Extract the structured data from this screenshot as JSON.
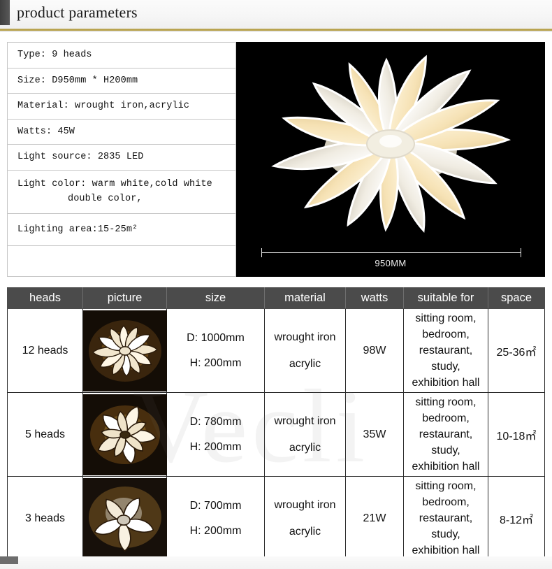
{
  "header": {
    "title": "product parameters"
  },
  "spec": {
    "rows": [
      {
        "text": "Type: 9 heads"
      },
      {
        "text": "Size: D950mm * H200mm"
      },
      {
        "text": "Material: wrought iron,acrylic"
      },
      {
        "text": "Watts: 45W"
      },
      {
        "text": "Light source: 2835 LED"
      },
      {
        "line1": "Light color: warm white,cold white",
        "line2": "double color,"
      },
      {
        "text": "Lighting area:15-25m²"
      },
      {
        "text": ""
      }
    ]
  },
  "photo": {
    "dimension_label": "950MM",
    "background_color": "#000000"
  },
  "comparison": {
    "headers": [
      "heads",
      "picture",
      "size",
      "material",
      "watts",
      "suitable for",
      "space"
    ],
    "rows": [
      {
        "heads": "12 heads",
        "picture": "lamp-12-heads-photo",
        "size_d": "D: 1000mm",
        "size_h": "H: 200mm",
        "material_1": "wrought iron",
        "material_2": "acrylic",
        "watts": "98W",
        "suitable_for": "sitting room, bedroom, restaurant, study, exhibition hall",
        "space": "25-36㎡"
      },
      {
        "heads": "5 heads",
        "picture": "lamp-5-heads-photo",
        "size_d": "D: 780mm",
        "size_h": "H: 200mm",
        "material_1": "wrought iron",
        "material_2": "acrylic",
        "watts": "35W",
        "suitable_for": "sitting room, bedroom, restaurant, study, exhibition hall",
        "space": "10-18㎡"
      },
      {
        "heads": "3 heads",
        "picture": "lamp-3-heads-photo",
        "size_d": "D: 700mm",
        "size_h": "H: 200mm",
        "material_1": "wrought iron",
        "material_2": "acrylic",
        "watts": "21W",
        "suitable_for": "sitting room, bedroom, restaurant, study, exhibition hall",
        "space": "8-12㎡"
      }
    ]
  },
  "watermark": {
    "text": "Vecli"
  },
  "colors": {
    "header_tab": "#4a4a4a",
    "gold_rule": "#b9a451",
    "table_header_bg": "#4b4b4b",
    "photo_bg": "#000000"
  }
}
